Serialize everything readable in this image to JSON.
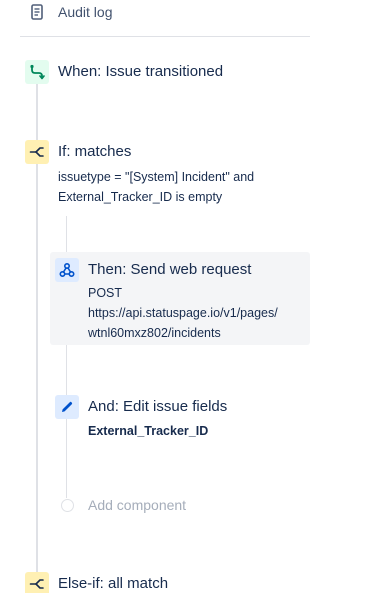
{
  "audit": {
    "label": "Audit log",
    "icon": "document-icon"
  },
  "trigger": {
    "title": "When: Issue transitioned",
    "icon": "branch-arrow-icon",
    "color": "#36b37e"
  },
  "condition": {
    "title": "If: matches",
    "detail_lines": [
      "issuetype = \"[System] Incident\" and",
      "External_Tracker_ID is empty"
    ],
    "icon": "fork-icon",
    "color": "#ff991f"
  },
  "action_webhook": {
    "title": "Then: Send web request",
    "detail_lines": [
      "POST",
      "https://api.statuspage.io/v1/pages/",
      "wtnl60mxz802/incidents"
    ],
    "icon": "webhook-icon",
    "color": "#0052cc"
  },
  "action_edit": {
    "title": "And: Edit issue fields",
    "detail": "External_Tracker_ID",
    "icon": "pencil-icon",
    "color": "#0052cc"
  },
  "add_component": {
    "label": "Add component"
  },
  "else_if": {
    "title": "Else-if: all match",
    "icon": "fork-icon"
  }
}
